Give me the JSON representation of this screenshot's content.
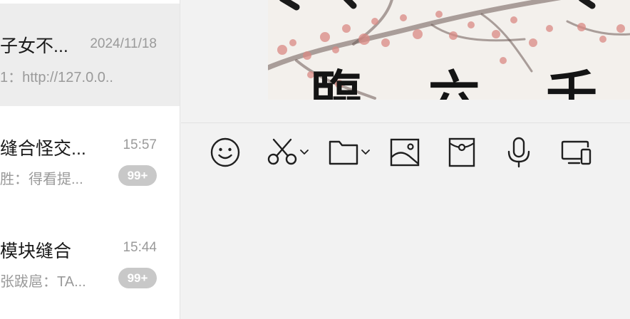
{
  "chat_list": {
    "items": [
      {
        "name": "子女不...",
        "time": "2024/11/18",
        "preview": "1：http://127.0.0...",
        "badge": "",
        "selected": true
      },
      {
        "name": "缝合怪交...",
        "time": "15:57",
        "preview": "胜：得看提...",
        "badge": "99+",
        "selected": false
      },
      {
        "name": "模块缝合",
        "time": "15:44",
        "preview": "张跋扈：TA...",
        "badge": "99+",
        "selected": false
      }
    ]
  },
  "message": {
    "image_text": "臨 六 千 仞"
  },
  "toolbar": {
    "buttons": [
      {
        "icon": "emoji-icon"
      },
      {
        "icon": "scissors-icon",
        "dropdown": true
      },
      {
        "icon": "folder-icon",
        "dropdown": true
      },
      {
        "icon": "image-icon"
      },
      {
        "icon": "red-packet-icon"
      },
      {
        "icon": "microphone-icon"
      },
      {
        "icon": "screen-share-icon"
      }
    ]
  },
  "colors": {
    "list_bg": "#ffffff",
    "selected_bg": "#ededed",
    "chat_bg": "#f2f2f2",
    "badge_bg": "#c8c8c8",
    "icon_stroke": "#1f1f1f"
  }
}
